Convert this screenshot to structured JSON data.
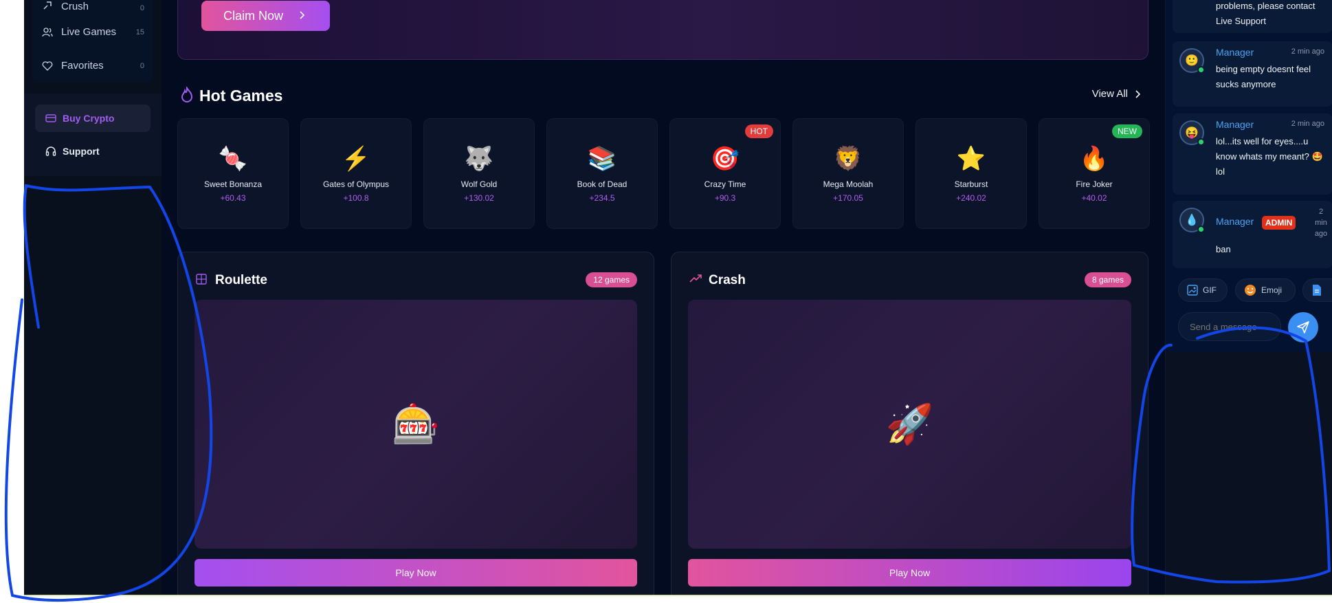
{
  "sidebar": {
    "nav": [
      {
        "label": "Crush",
        "count": "0",
        "icon": "rocket-icon"
      },
      {
        "label": "Live Games",
        "count": "15",
        "icon": "users-icon"
      },
      {
        "label": "Favorites",
        "count": "0",
        "icon": "heart-icon"
      }
    ],
    "buy_crypto": "Buy Crypto",
    "support": "Support"
  },
  "promo": {
    "claim_label": "Claim Now"
  },
  "hot_games": {
    "title": "Hot Games",
    "view_all": "View All",
    "games": [
      {
        "name": "Sweet Bonanza",
        "value": "+60.43",
        "emoji": "🍬",
        "badge": ""
      },
      {
        "name": "Gates of Olympus",
        "value": "+100.8",
        "emoji": "⚡",
        "badge": ""
      },
      {
        "name": "Wolf Gold",
        "value": "+130.02",
        "emoji": "🐺",
        "badge": ""
      },
      {
        "name": "Book of Dead",
        "value": "+234.5",
        "emoji": "📚",
        "badge": ""
      },
      {
        "name": "Crazy Time",
        "value": "+90.3",
        "emoji": "🎯",
        "badge": "HOT"
      },
      {
        "name": "Mega Moolah",
        "value": "+170.05",
        "emoji": "🦁",
        "badge": ""
      },
      {
        "name": "Starburst",
        "value": "+240.02",
        "emoji": "⭐",
        "badge": ""
      },
      {
        "name": "Fire Joker",
        "value": "+40.02",
        "emoji": "🔥",
        "badge": "NEW"
      }
    ]
  },
  "categories": [
    {
      "title": "Roulette",
      "badge": "12 games",
      "emoji": "🎰",
      "play": "Play Now"
    },
    {
      "title": "Crash",
      "badge": "8 games",
      "emoji": "🚀",
      "play": "Play Now"
    }
  ],
  "chat": {
    "top_text": "problems, please contact Live Support",
    "messages": [
      {
        "user": "Manager",
        "time": "2 min ago",
        "text": "being empty doesnt feel sucks anymore",
        "avatar": "🙂",
        "admin": ""
      },
      {
        "user": "Manager",
        "time": "2 min ago",
        "text": "lol...its well for eyes....u know whats my meant? 🤩 lol",
        "avatar": "😝",
        "admin": ""
      },
      {
        "user": "Manager",
        "time": "2 min ago",
        "text": "ban",
        "avatar": "💧",
        "admin": "ADMIN"
      }
    ],
    "tools": {
      "gif": "GIF",
      "emoji": "Emoji"
    },
    "input_placeholder": "Send a message"
  },
  "colors": {
    "accent_purple": "#a44ff0",
    "accent_pink": "#e2549d",
    "annotation_blue": "#1346e6"
  }
}
